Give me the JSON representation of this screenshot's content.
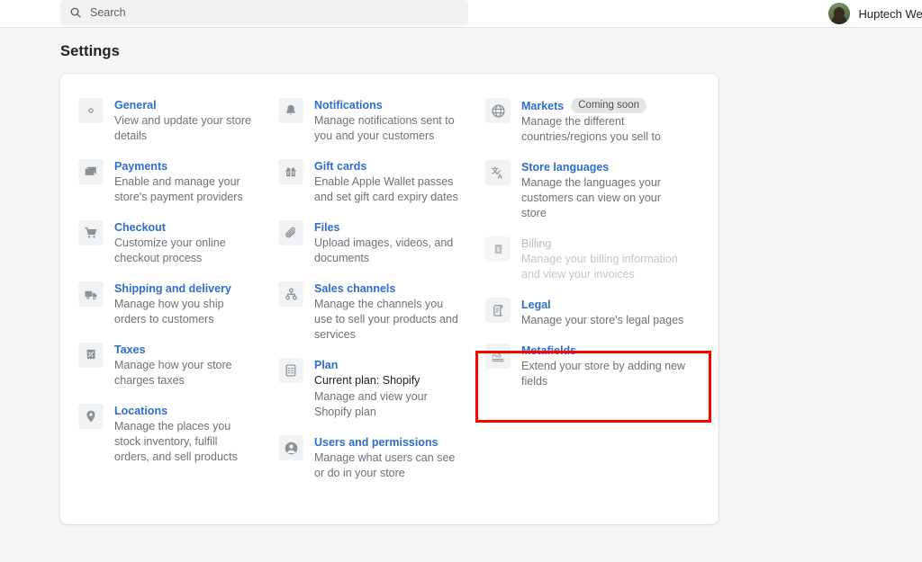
{
  "topbar": {
    "search": {
      "placeholder": "Search",
      "icon": "search-icon"
    },
    "user": {
      "name": "Huptech Web",
      "avatar_icon": "user-avatar"
    }
  },
  "page": {
    "title": "Settings"
  },
  "highlight": {
    "target": "Metafields",
    "color": "#ff0000"
  },
  "columns": [
    {
      "items": [
        {
          "icon": "gear-icon",
          "title": "General",
          "desc": "View and update your store details",
          "disabled": false
        },
        {
          "icon": "credit-card-icon",
          "title": "Payments",
          "desc": "Enable and manage your store's payment providers",
          "disabled": false
        },
        {
          "icon": "shopping-cart-icon",
          "title": "Checkout",
          "desc": "Customize your online checkout process",
          "disabled": false
        },
        {
          "icon": "truck-icon",
          "title": "Shipping and delivery",
          "desc": "Manage how you ship orders to customers",
          "disabled": false
        },
        {
          "icon": "receipt-percent-icon",
          "title": "Taxes",
          "desc": "Manage how your store charges taxes",
          "disabled": false
        },
        {
          "icon": "location-pin-icon",
          "title": "Locations",
          "desc": "Manage the places you stock inventory, fulfill orders, and sell products",
          "disabled": false
        }
      ]
    },
    {
      "items": [
        {
          "icon": "bell-icon",
          "title": "Notifications",
          "desc": "Manage notifications sent to you and your customers",
          "disabled": false
        },
        {
          "icon": "gift-card-icon",
          "title": "Gift cards",
          "desc": "Enable Apple Wallet passes and set gift card expiry dates",
          "disabled": false
        },
        {
          "icon": "paperclip-icon",
          "title": "Files",
          "desc": "Upload images, videos, and documents",
          "disabled": false
        },
        {
          "icon": "sales-channels-icon",
          "title": "Sales channels",
          "desc": "Manage the channels you use to sell your products and services",
          "disabled": false
        },
        {
          "icon": "plan-list-icon",
          "title": "Plan",
          "sub": "Current plan: Shopify",
          "desc": "Manage and view your Shopify plan",
          "disabled": false
        },
        {
          "icon": "user-circle-icon",
          "title": "Users and permissions",
          "desc": "Manage what users can see or do in your store",
          "disabled": false
        }
      ]
    },
    {
      "items": [
        {
          "icon": "globe-icon",
          "title": "Markets",
          "badge": "Coming soon",
          "desc": "Manage the different countries/regions you sell to",
          "disabled": false
        },
        {
          "icon": "translate-icon",
          "title": "Store languages",
          "desc": "Manage the languages your customers can view on your store",
          "disabled": false
        },
        {
          "icon": "billing-receipt-icon",
          "title": "Billing",
          "desc": "Manage your billing information and view your invoices",
          "disabled": true
        },
        {
          "icon": "legal-scroll-icon",
          "title": "Legal",
          "desc": "Manage your store's legal pages",
          "disabled": false
        },
        {
          "icon": "metafields-aa-icon",
          "title": "Metafields",
          "desc": "Extend your store by adding new fields",
          "disabled": false
        }
      ]
    }
  ]
}
